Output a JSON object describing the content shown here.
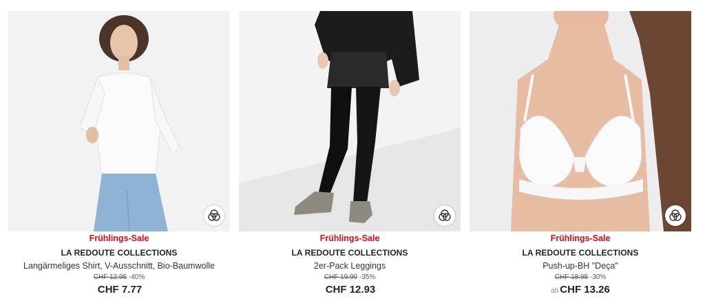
{
  "products": [
    {
      "sale_label": "Frühlings-Sale",
      "brand": "LA REDOUTE COLLECTIONS",
      "title": "Langärmeliges Shirt, V-Ausschnitt, Bio-Baumwolle",
      "old_price": "CHF 12.95",
      "discount": "-40%",
      "price_prefix": "",
      "price": "CHF 7.77"
    },
    {
      "sale_label": "Frühlings-Sale",
      "brand": "LA REDOUTE COLLECTIONS",
      "title": "2er-Pack Leggings",
      "old_price": "CHF 19.90",
      "discount": "-35%",
      "price_prefix": "",
      "price": "CHF 12.93"
    },
    {
      "sale_label": "Frühlings-Sale",
      "brand": "LA REDOUTE COLLECTIONS",
      "title": "Push-up-BH \"Deça\"",
      "old_price": "CHF 18.95",
      "discount": "-30%",
      "price_prefix": "ab",
      "price": "CHF 13.26"
    }
  ],
  "colors": {
    "sale": "#e30613",
    "text": "#222222"
  },
  "icons": {
    "variant": "color-variants-icon"
  }
}
